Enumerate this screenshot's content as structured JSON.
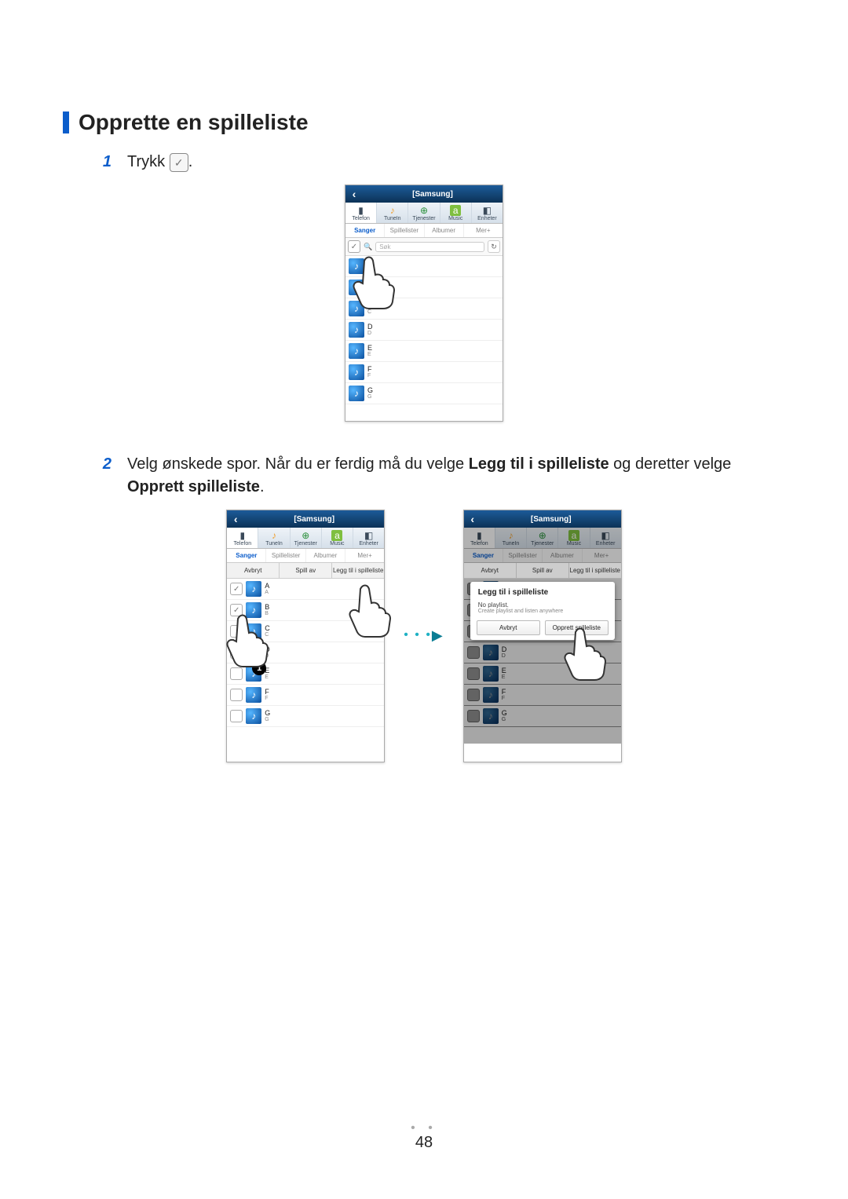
{
  "heading": "Opprette en spilleliste",
  "steps": {
    "one": {
      "num": "1",
      "text_a": "Trykk",
      "text_b": "."
    },
    "two": {
      "num": "2",
      "text_a": "Velg ønskede spor. Når du er ferdig må du velge ",
      "bold1": "Legg til i spilleliste",
      "text_b": " og deretter velge ",
      "bold2": "Opprett spilleliste",
      "text_c": "."
    }
  },
  "phone_common": {
    "title": "[Samsung]",
    "nav": [
      {
        "icon": "📱",
        "label": "Telefon"
      },
      {
        "icon": "🎵",
        "label": "TuneIn"
      },
      {
        "icon": "🌐",
        "label": "Tjenester"
      },
      {
        "icon": "a",
        "label": "Music"
      },
      {
        "icon": "📟",
        "label": "Enheter"
      }
    ],
    "tabs": {
      "sanger": "Sanger",
      "spillelister": "Spillelister",
      "albumer": "Albumer",
      "mer": "Mer+"
    },
    "search_placeholder": "Søk",
    "songs": [
      {
        "t1": "A",
        "t2": "A"
      },
      {
        "t1": "B",
        "t2": "B"
      },
      {
        "t1": "C",
        "t2": "C"
      },
      {
        "t1": "D",
        "t2": "D"
      },
      {
        "t1": "E",
        "t2": "E"
      },
      {
        "t1": "F",
        "t2": "F"
      },
      {
        "t1": "G",
        "t2": "G"
      }
    ],
    "actions": {
      "cancel": "Avbryt",
      "play": "Spill av",
      "add": "Legg til i spilleliste"
    }
  },
  "dialog": {
    "title": "Legg til i spilleliste",
    "sub1": "No playlist.",
    "sub2": "Create playlist and listen anywhere",
    "cancel": "Avbryt",
    "create": "Opprett spilleliste"
  },
  "page_number": "48"
}
